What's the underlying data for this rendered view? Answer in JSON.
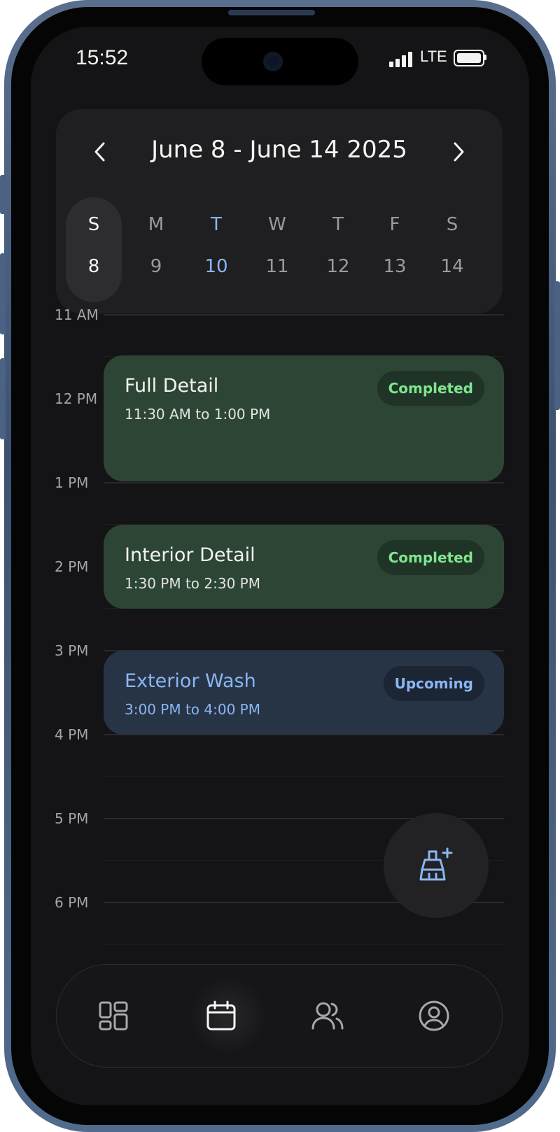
{
  "status_bar": {
    "time": "15:52",
    "network": "LTE"
  },
  "week": {
    "range_title": "June 8 - June 14 2025",
    "prev_icon": "chevron-left-icon",
    "next_icon": "chevron-right-icon",
    "days": [
      {
        "letter": "S",
        "date": "8",
        "state": "selected"
      },
      {
        "letter": "M",
        "date": "9",
        "state": "normal"
      },
      {
        "letter": "T",
        "date": "10",
        "state": "today"
      },
      {
        "letter": "W",
        "date": "11",
        "state": "normal"
      },
      {
        "letter": "T",
        "date": "12",
        "state": "normal"
      },
      {
        "letter": "F",
        "date": "13",
        "state": "normal"
      },
      {
        "letter": "S",
        "date": "14",
        "state": "normal"
      }
    ]
  },
  "timeline": {
    "hours": [
      "11 AM",
      "12 PM",
      "1 PM",
      "2 PM",
      "3 PM",
      "4 PM",
      "5 PM",
      "6 PM"
    ]
  },
  "events": [
    {
      "title": "Full Detail",
      "time": "11:30 AM to 1:00 PM",
      "status": "Completed"
    },
    {
      "title": "Interior Detail",
      "time": "1:30 PM to 2:30 PM",
      "status": "Completed"
    },
    {
      "title": "Exterior Wash",
      "time": "3:00 PM to 4:00 PM",
      "status": "Upcoming"
    }
  ],
  "fab": {
    "icon": "broom-plus-icon"
  },
  "tabbar": {
    "tabs": [
      {
        "icon": "dashboard-icon"
      },
      {
        "icon": "calendar-icon",
        "active": true
      },
      {
        "icon": "users-icon"
      },
      {
        "icon": "profile-icon"
      }
    ]
  },
  "colors": {
    "background": "#141416",
    "accent_blue": "#8ab6f2",
    "completed_green": "#7fe58f",
    "event_green_bg": "#2d4535",
    "event_blue_bg": "#273445"
  }
}
